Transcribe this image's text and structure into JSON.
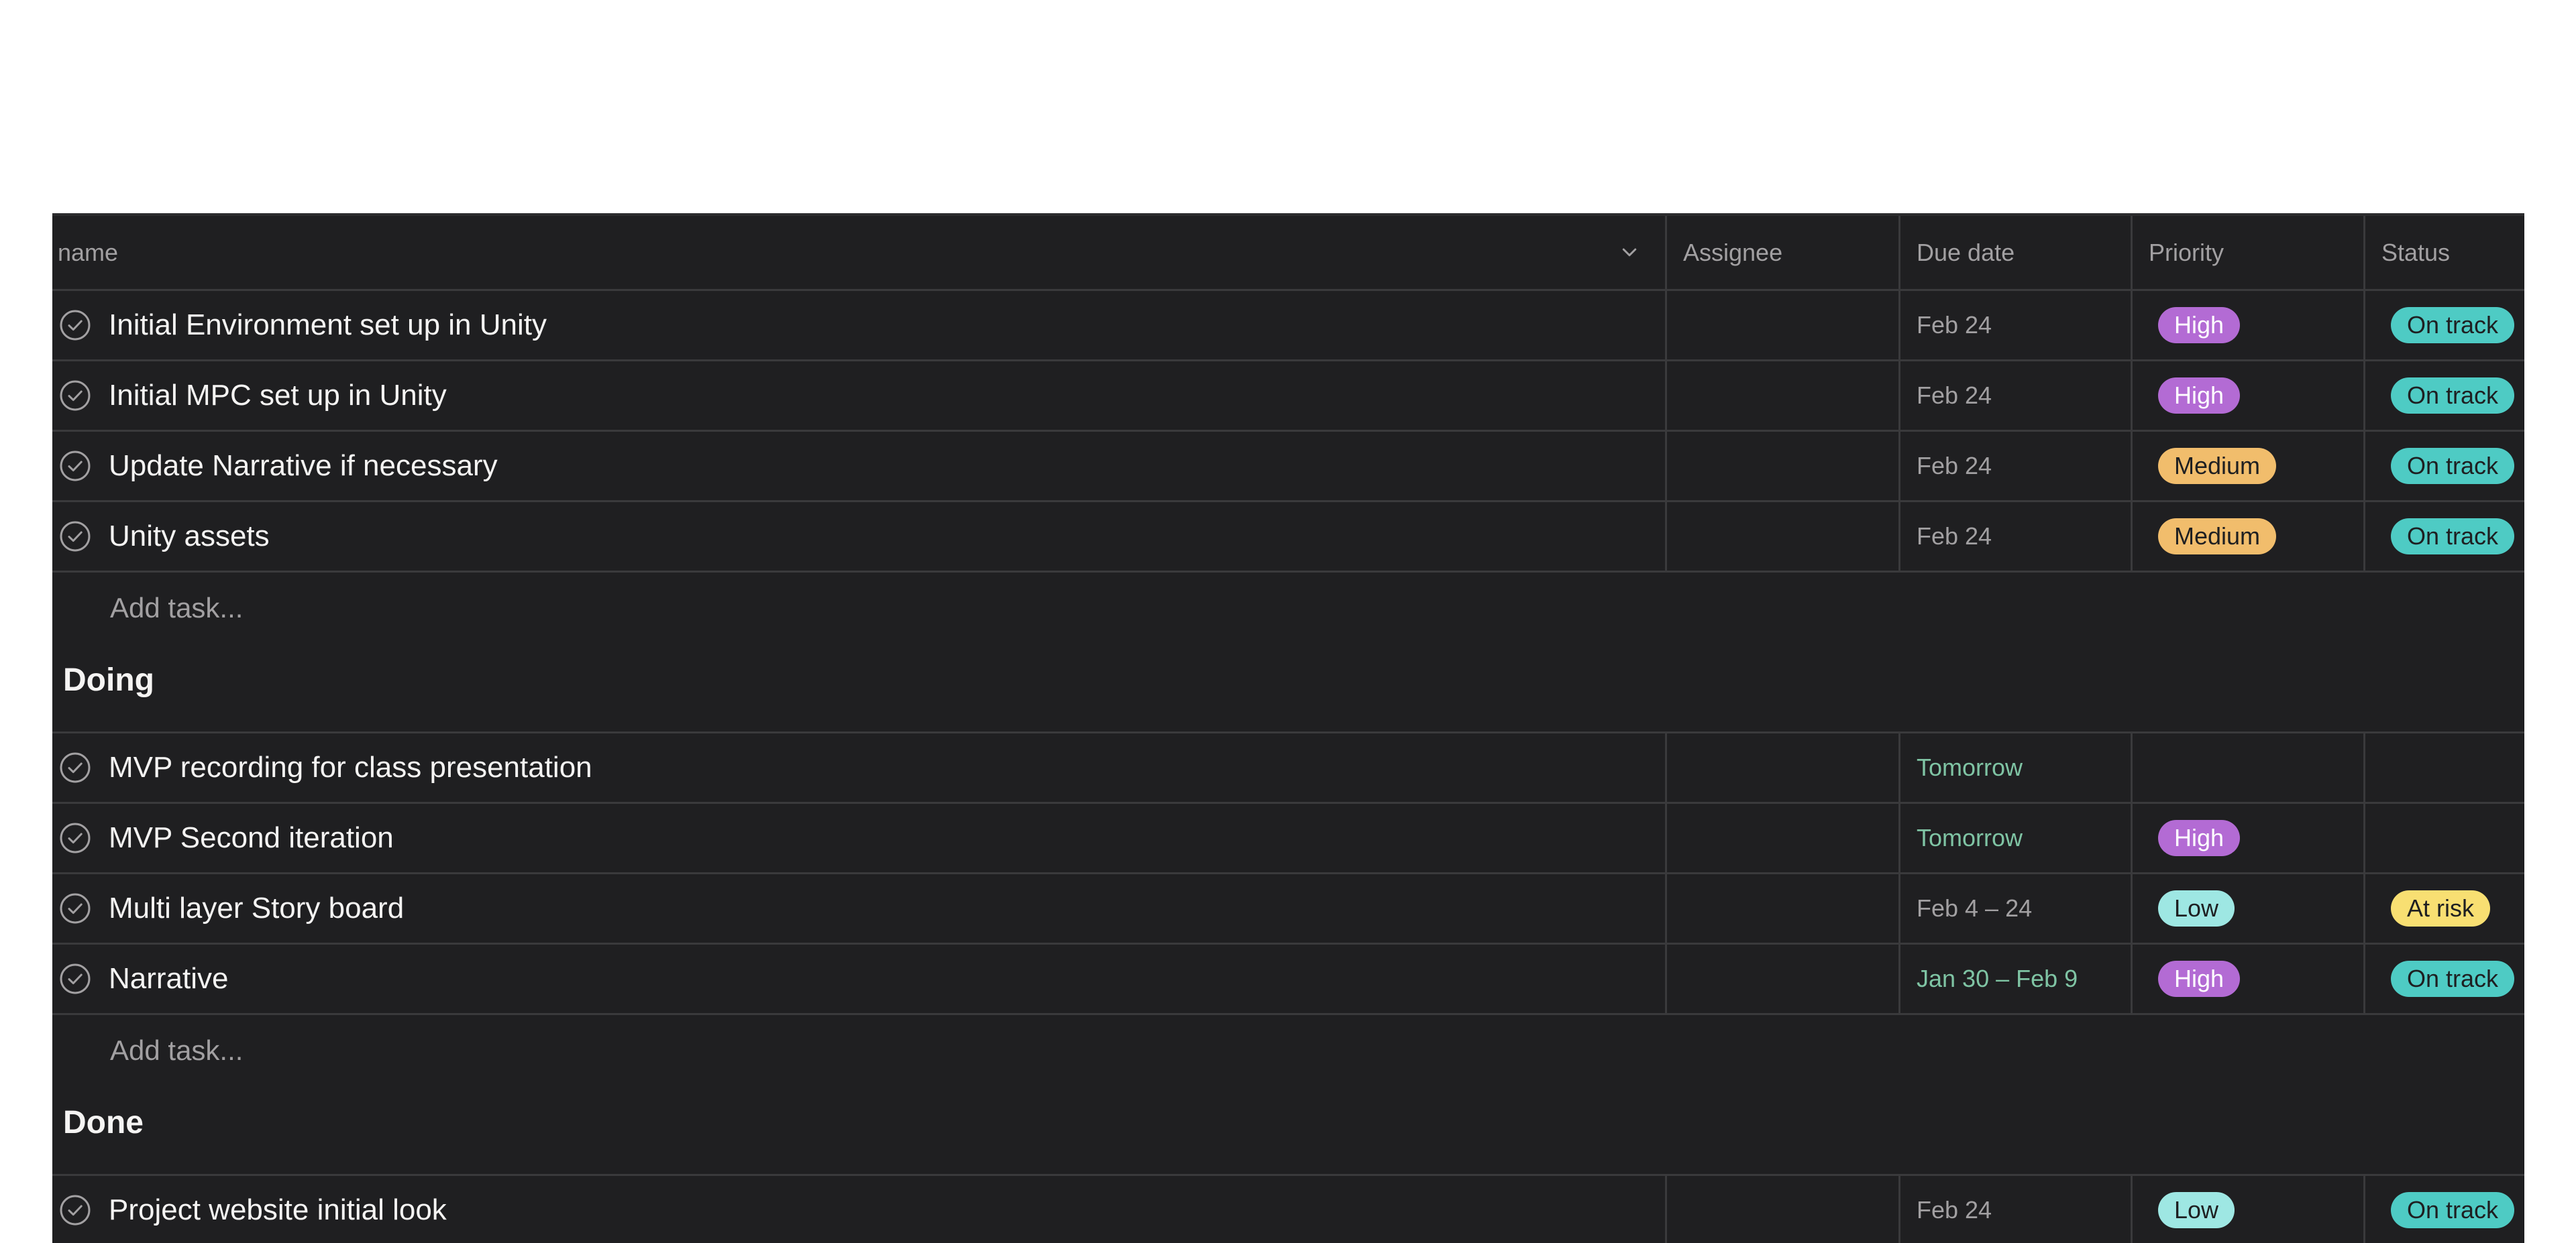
{
  "header": {
    "name": "name",
    "assignee": "Assignee",
    "due_date": "Due date",
    "priority": "Priority",
    "status": "Status"
  },
  "colors": {
    "background": "#1f1f21",
    "grid_line": "#3a3a3c",
    "high": "#b36bd4",
    "medium": "#f1bd6c",
    "low": "#9ee7e3",
    "on_track": "#4ecbc4",
    "at_risk": "#f8df72",
    "green_due": "#7fc4a4"
  },
  "groups": [
    {
      "title": "",
      "add_task_label": "Add task...",
      "tasks": [
        {
          "name": "Initial Environment set up in Unity",
          "due": "Feb 24",
          "due_style": "normal",
          "priority": "High",
          "status": "On track"
        },
        {
          "name": "Initial MPC set up in Unity",
          "due": "Feb 24",
          "due_style": "normal",
          "priority": "High",
          "status": "On track"
        },
        {
          "name": "Update Narrative if necessary",
          "due": "Feb 24",
          "due_style": "normal",
          "priority": "Medium",
          "status": "On track"
        },
        {
          "name": "Unity assets",
          "due": "Feb 24",
          "due_style": "normal",
          "priority": "Medium",
          "status": "On track"
        }
      ]
    },
    {
      "title": "Doing",
      "add_task_label": "Add task...",
      "tasks": [
        {
          "name": "MVP recording for class presentation",
          "due": "Tomorrow",
          "due_style": "green",
          "priority": "",
          "status": ""
        },
        {
          "name": "MVP Second iteration",
          "due": "Tomorrow",
          "due_style": "green",
          "priority": "High",
          "status": ""
        },
        {
          "name": "Multi layer Story board",
          "due": "Feb 4 – 24",
          "due_style": "normal",
          "priority": "Low",
          "status": "At risk"
        },
        {
          "name": "Narrative",
          "due": "Jan 30 – Feb 9",
          "due_style": "green",
          "priority": "High",
          "status": "On track"
        }
      ]
    },
    {
      "title": "Done",
      "add_task_label": "",
      "tasks": [
        {
          "name": "Project website initial look",
          "due": "Feb 24",
          "due_style": "normal",
          "priority": "Low",
          "status": "On track"
        }
      ]
    }
  ]
}
